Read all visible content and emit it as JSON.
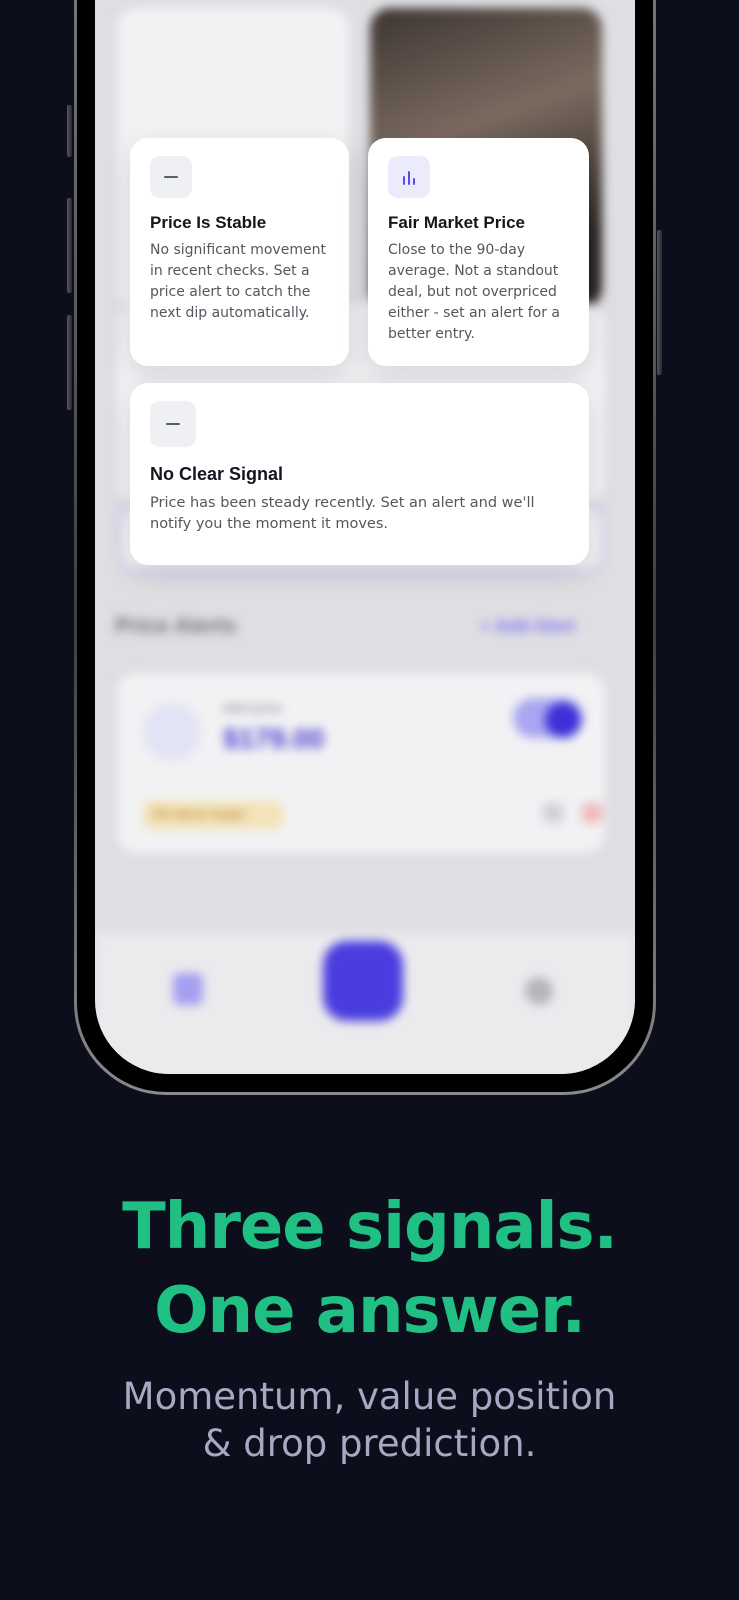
{
  "cards": [
    {
      "icon": "minus-icon",
      "title": "Price Is Stable",
      "body": "No significant movement in recent checks. Set a price alert to catch the next dip automatically."
    },
    {
      "icon": "bar-chart-icon",
      "title": "Fair Market Price",
      "body": "Close to the 90-day average. Not a standout deal, but not overpriced either - set an alert for a better entry."
    },
    {
      "icon": "minus-icon",
      "title": "No Clear Signal",
      "body": "Price has been steady recently. Set an alert and we'll notify you the moment it moves."
    }
  ],
  "background_app": {
    "section_title": "Price Alerts",
    "add_alert_label": "+ Add Alert",
    "alert_price": "$179.00",
    "alert_label": "Alert price",
    "alert_badge": "5% above target"
  },
  "marketing": {
    "headline_line1": "Three signals.",
    "headline_line2": "One answer.",
    "subhead_line1": "Momentum, value position",
    "subhead_line2": "& drop prediction."
  },
  "colors": {
    "background": "#0c0e1c",
    "headline": "#20c084",
    "subhead": "#a7a9c3",
    "accent": "#4f3fe0"
  }
}
